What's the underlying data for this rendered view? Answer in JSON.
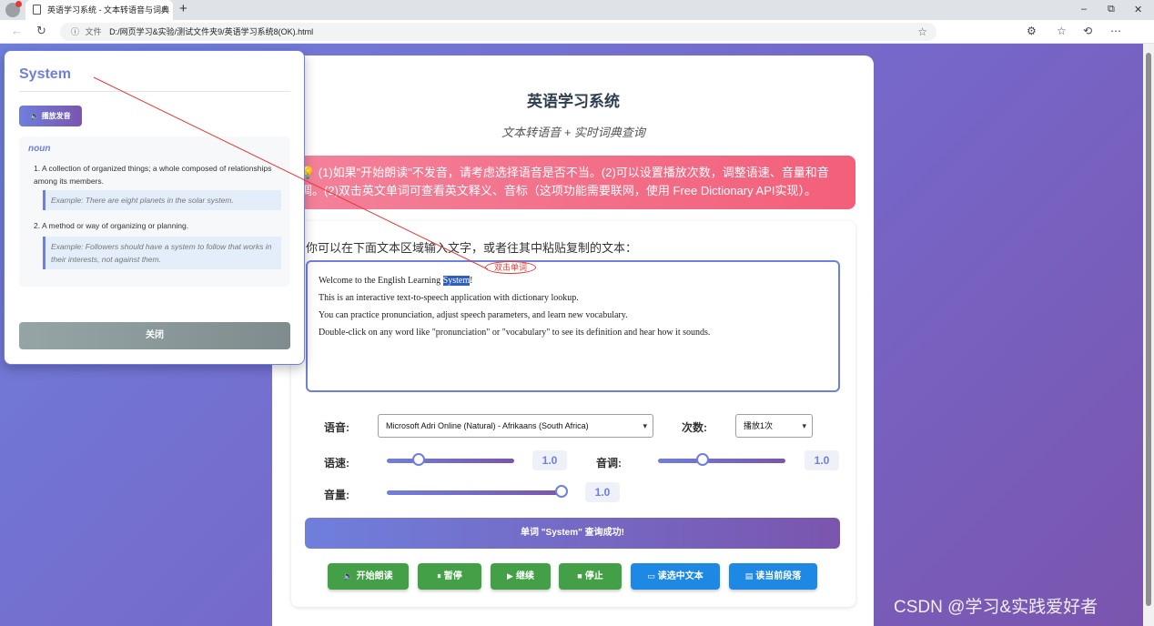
{
  "browser": {
    "tab_title": "英语学习系统 - 文本转语音与词典",
    "new_tab": "+",
    "close_tab": "×",
    "minimize": "–",
    "restore": "⧉",
    "close_window": "✕",
    "url_info": "ⓘ",
    "file_label": "文件",
    "url": "D:/网页学习&实验/测试文件夹9/英语学习系统8(OK).html"
  },
  "page": {
    "title": "英语学习系统",
    "subtitle": "文本转语音 + 实时词典查询",
    "notice": "💡 (1)如果\"开始朗读\"不发音，请考虑选择语音是否不当。(2)可以设置播放次数，调整语速、音量和音调。(2)双击英文单词可查看英文释义、音标（这项功能需要联网，使用 Free Dictionary API实现）。",
    "input_label": "你可以在下面文本区域输入文字，或者往其中粘贴复制的文本：",
    "text": {
      "line1_before": "Welcome to the English Learning ",
      "line1_selected": "System",
      "line1_after": "!",
      "line2": "This is an interactive text-to-speech application with dictionary lookup.",
      "line3": "You can practice pronunciation, adjust speech parameters, and learn new vocabulary.",
      "line4": "Double-click on any word like \"pronunciation\" or \"vocabulary\" to see its definition and hear how it sounds."
    },
    "annotation": "双击单词",
    "controls": {
      "voice_label": "语音:",
      "voice_value": "Microsoft Adri Online (Natural) - Afrikaans (South Africa)",
      "count_label": "次数:",
      "count_value": "播放1次",
      "rate_label": "语速:",
      "rate_value": "1.0",
      "rate_level": 0.25,
      "pitch_label": "音调:",
      "pitch_value": "1.0",
      "pitch_level": 0.35,
      "volume_label": "音量:",
      "volume_value": "1.0",
      "volume_level": 1.0
    },
    "status": "单词 \"System\" 查询成功!",
    "buttons": {
      "start": "开始朗读",
      "pause": "暂停",
      "resume": "继续",
      "stop": "停止",
      "read_selected": "读选中文本",
      "read_paragraph": "读当前段落"
    }
  },
  "popup": {
    "word": "System",
    "play": "播放发音",
    "part_of_speech": "noun",
    "definitions": [
      {
        "n": "1.",
        "text": "A collection of organized things; a whole composed of relationships among its members.",
        "example": "Example: There are eight planets in the solar system."
      },
      {
        "n": "2.",
        "text": "A method or way of organizing or planning.",
        "example": "Example: Followers should have a system to follow that works in their interests, not against them."
      }
    ],
    "close": "关闭"
  },
  "watermark": "CSDN @学习&实践爱好者",
  "colors": {
    "accent": "#6f7fdc",
    "accent2": "#7a55ae",
    "notice": "#f35f7a",
    "green": "#43a047",
    "blue": "#1e88e5",
    "annotation": "#e53935"
  }
}
